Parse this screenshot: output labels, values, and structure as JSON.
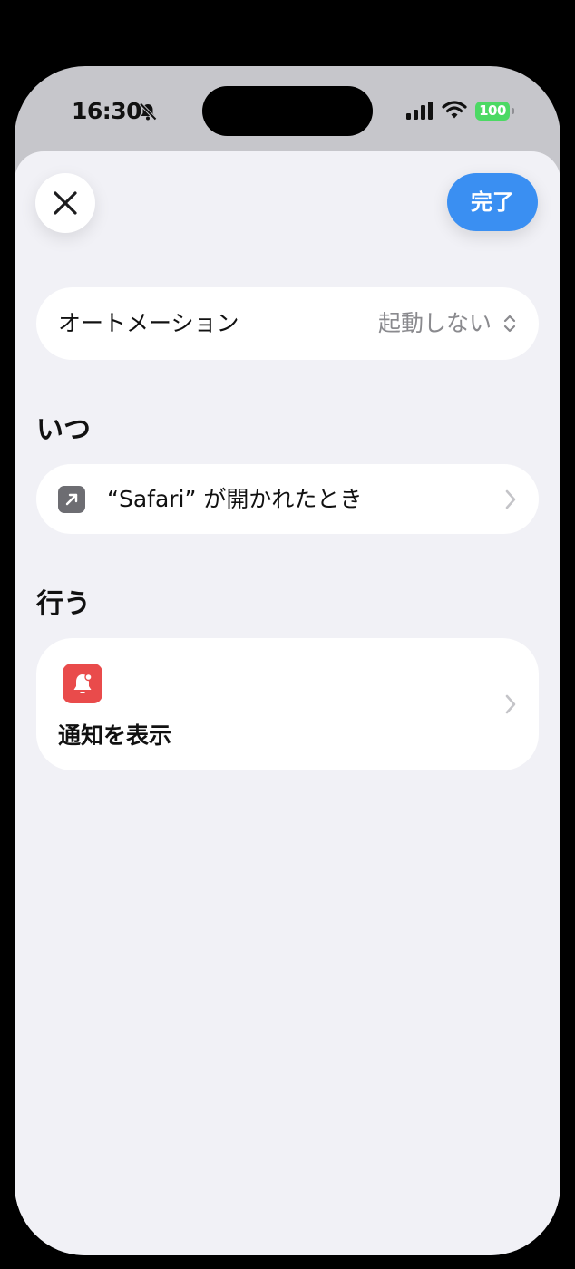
{
  "status_bar": {
    "time": "16:30",
    "battery": "100",
    "icons": [
      "bell-slash-icon",
      "cellular-signal-icon",
      "wifi-icon",
      "battery-icon"
    ]
  },
  "header": {
    "close_icon": "close-icon",
    "done_label": "完了"
  },
  "automation": {
    "label": "オートメーション",
    "value": "起動しない",
    "icon": "chevron-up-down-icon"
  },
  "when": {
    "heading": "いつ",
    "trigger_label": "“Safari” が開かれたとき",
    "icon": "open-app-arrow-icon"
  },
  "do": {
    "heading": "行う",
    "action_label": "通知を表示",
    "icon": "notification-bell-icon"
  },
  "colors": {
    "accent": "#3a8ff2",
    "notification": "#e94b4b",
    "battery": "#4cd964",
    "sheet_background": "#f1f1f6"
  }
}
